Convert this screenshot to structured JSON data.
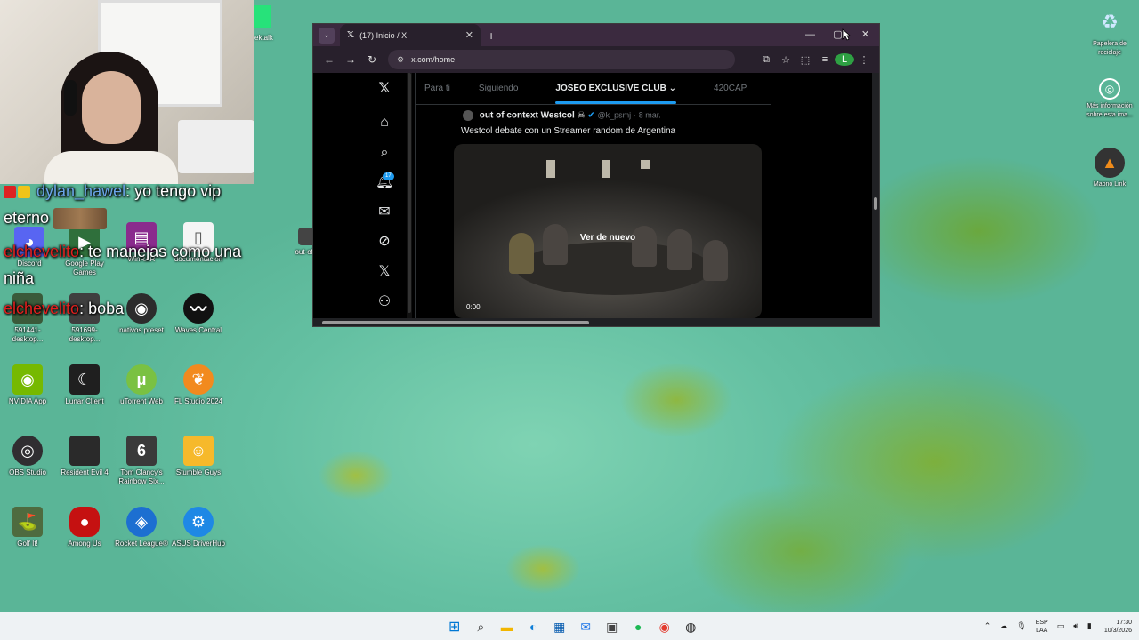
{
  "chat": {
    "lines": [
      {
        "user": "dylan_hawel",
        "message": ": yo tengo vip eterno"
      },
      {
        "user": "elchevelito",
        "message": ": te manejas como una niña"
      },
      {
        "user": "elchevelito",
        "message": ": boba"
      }
    ]
  },
  "desktop_icons": {
    "row1": [
      "Discord",
      "Google Play Games",
      "WinRAR",
      "documentación"
    ],
    "row2": [
      "591441-desktop...",
      "591699-desktop...",
      "nativos preset",
      "Waves Central"
    ],
    "row3": [
      "NVIDIA App",
      "Lunar Client",
      "uTorrent Web",
      "FL Studio 2024"
    ],
    "row4": [
      "OBS Studio",
      "Resident Evil 4",
      "Tom Clancy's Rainbow Six...",
      "Stumble Guys"
    ],
    "row5": [
      "Golf It!",
      "Among Us",
      "Rocket League®",
      "ASUS DriverHub"
    ],
    "extra": "out-of..."
  },
  "right_icons": {
    "recycle": "Papelera de reciclaje",
    "info": "Más información sobre esta ima...",
    "magic": "Maono Link"
  },
  "webcam_tag": "ektalk",
  "browser": {
    "tab_title": "(17) Inicio / X",
    "url": "x.com/home",
    "tabs": [
      "Para ti",
      "Siguiendo",
      "JOSEO EXCLUSIVE CLUB",
      "420CAP"
    ],
    "notif_count": "17",
    "tweet": {
      "name": "out of context Westcol",
      "handle": "@k_psmj",
      "date": "8 mar.",
      "text": "Westcol debate con un Streamer random de Argentina",
      "replay": "Ver de nuevo",
      "time": "0:00"
    }
  },
  "taskbar": {
    "lang1": "ESP",
    "lang2": "LAA",
    "time": "17:30",
    "date": "10/3/2026"
  }
}
